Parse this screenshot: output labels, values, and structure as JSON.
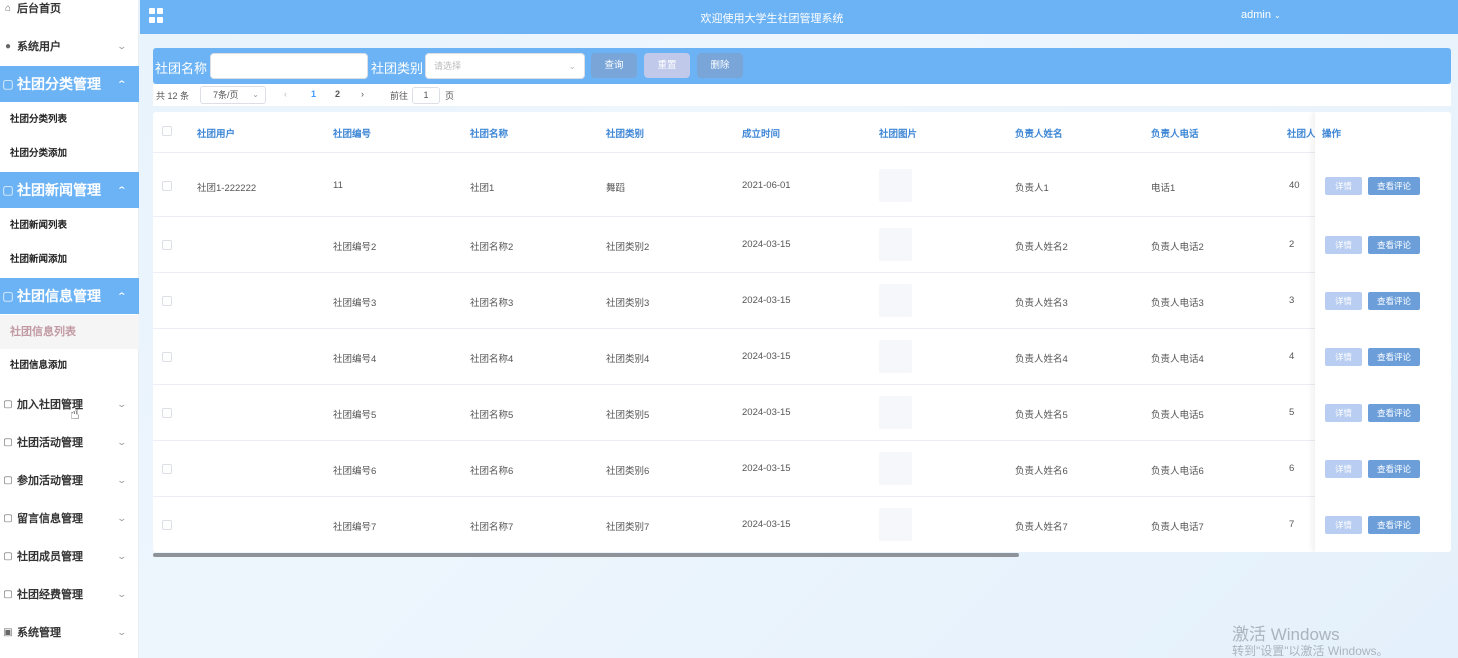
{
  "sidebar": {
    "home": "后台首页",
    "system_users": "系统用户",
    "groups": [
      {
        "title": "社团分类管理",
        "items": [
          "社团分类列表",
          "社团分类添加"
        ]
      },
      {
        "title": "社团新闻管理",
        "items": [
          "社团新闻列表",
          "社团新闻添加"
        ]
      },
      {
        "title": "社团信息管理",
        "items": [
          "社团信息列表",
          "社团信息添加"
        ]
      }
    ],
    "collapsed": [
      "加入社团管理",
      "社团活动管理",
      "参加活动管理",
      "留言信息管理",
      "社团成员管理",
      "社团经费管理",
      "系统管理"
    ]
  },
  "header": {
    "title": "欢迎使用大学生社团管理系统",
    "user": "admin"
  },
  "search": {
    "name_label": "社团名称",
    "name_value": "",
    "type_label": "社团类别",
    "type_placeholder": "请选择",
    "query_button": "查询",
    "reset_button": "重置",
    "delete_button": "删除"
  },
  "pagination": {
    "total": "共 12 条",
    "page_size": "7条/页",
    "pages": [
      "1",
      "2"
    ],
    "current_page": 1,
    "goto_label": "前往",
    "goto_value": "1",
    "page_suffix": "页"
  },
  "table": {
    "columns": [
      "社团用户",
      "社团编号",
      "社团名称",
      "社团类别",
      "成立时间",
      "社团图片",
      "负责人姓名",
      "负责人电话",
      "社团人",
      "操作"
    ],
    "rows": [
      [
        "社团1-222222",
        "11",
        "社团1",
        "舞蹈",
        "2021-06-01",
        "负责人1",
        "电话1",
        "40"
      ],
      [
        "",
        "社团编号2",
        "社团名称2",
        "社团类别2",
        "2024-03-15",
        "负责人姓名2",
        "负责人电话2",
        "2"
      ],
      [
        "",
        "社团编号3",
        "社团名称3",
        "社团类别3",
        "2024-03-15",
        "负责人姓名3",
        "负责人电话3",
        "3"
      ],
      [
        "",
        "社团编号4",
        "社团名称4",
        "社团类别4",
        "2024-03-15",
        "负责人姓名4",
        "负责人电话4",
        "4"
      ],
      [
        "",
        "社团编号5",
        "社团名称5",
        "社团类别5",
        "2024-03-15",
        "负责人姓名5",
        "负责人电话5",
        "5"
      ],
      [
        "",
        "社团编号6",
        "社团名称6",
        "社团类别6",
        "2024-03-15",
        "负责人姓名6",
        "负责人电话6",
        "6"
      ],
      [
        "",
        "社团编号7",
        "社团名称7",
        "社团类别7",
        "2024-03-15",
        "负责人姓名7",
        "负责人电话7",
        "7"
      ]
    ],
    "detail_button": "详情",
    "review_button": "查看评论"
  },
  "watermark": {
    "line1": "激活 Windows",
    "line2": "转到\"设置\"以激活 Windows。"
  },
  "colors": {
    "accent": "#6cb3f5",
    "header_text": "#3f87d6",
    "detail_button": "#b8cdf1",
    "review_button": "#6c9fd9"
  },
  "icons": [
    "home-icon",
    "user-icon",
    "folder-icon",
    "chevron-up-icon",
    "chevron-down-icon",
    "grid-menu-icon",
    "caret-down-icon",
    "chevron-left-icon",
    "chevron-right-icon",
    "image-icon"
  ]
}
